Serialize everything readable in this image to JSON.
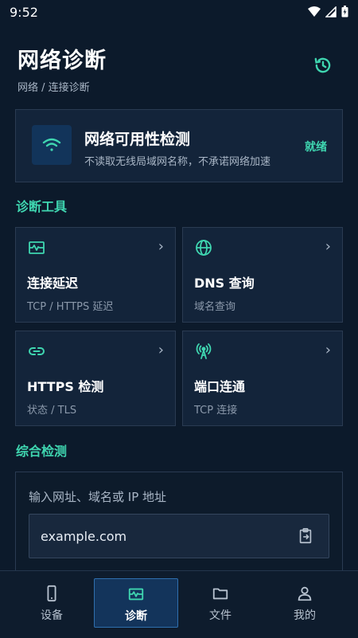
{
  "status_bar": {
    "time": "9:52"
  },
  "header": {
    "title": "网络诊断",
    "breadcrumb": "网络 / 连接诊断",
    "history_icon": "history-icon"
  },
  "status_card": {
    "title": "网络可用性检测",
    "subtitle": "不读取无线局域网名称，不承诺网络加速",
    "state": "就绪",
    "icon": "wifi-icon"
  },
  "tools_section": {
    "label": "诊断工具",
    "items": [
      {
        "name": "连接延迟",
        "sub": "TCP / HTTPS 延迟",
        "icon": "pulse-icon"
      },
      {
        "name": "DNS 查询",
        "sub": "域名查询",
        "icon": "globe-icon"
      },
      {
        "name": "HTTPS 检测",
        "sub": "状态 / TLS",
        "icon": "link-icon"
      },
      {
        "name": "端口连通",
        "sub": "TCP 连接",
        "icon": "antenna-icon"
      }
    ]
  },
  "composite_section": {
    "label": "综合检测",
    "input_label": "输入网址、域名或 IP 地址",
    "input_value": "example.com",
    "paste_icon": "paste-icon"
  },
  "bottom_nav": {
    "items": [
      {
        "label": "设备",
        "icon": "phone-icon",
        "active": false
      },
      {
        "label": "诊断",
        "icon": "pulse-icon",
        "active": true
      },
      {
        "label": "文件",
        "icon": "folder-icon",
        "active": false
      },
      {
        "label": "我的",
        "icon": "person-icon",
        "active": false
      }
    ]
  },
  "colors": {
    "accent": "#3fd6b0",
    "background": "#0c1a2b",
    "card": "#13243a"
  }
}
